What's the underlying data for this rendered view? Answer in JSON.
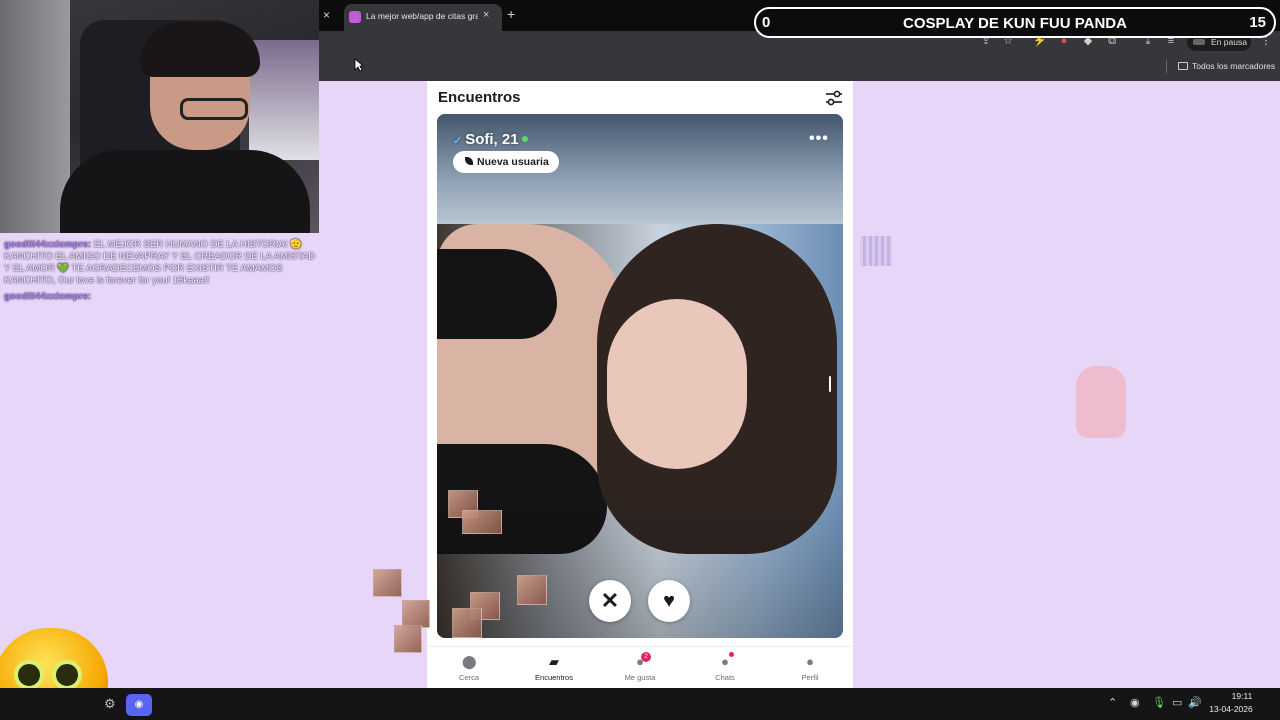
{
  "browser": {
    "tab_title": "La mejor web/app de citas gratis",
    "tab_close": "×",
    "new_tab": "+",
    "close_left": "×",
    "profile_status": "En pausa",
    "all_bookmarks": "Todos los marcadores"
  },
  "stream": {
    "left_counter": "0",
    "title": "COSPLAY DE KUN FUU PANDA",
    "right_counter": "15"
  },
  "chat": {
    "messages": [
      {
        "user": "goodlii44xxiompre:",
        "text": "EL MEJOR SER HUMANO DE LA HISTORIA! 🫡 KANCHITO EL AMIGO DE NEVAPRAY Y EL CREADOR DE LA AMISTAD Y EL AMOR 💚 TE AGRADECEMOS POR EXISTIR TE AMAMOS KANCHITO, Our love is forever for you! 15kaaa!!"
      },
      {
        "user": "goodlii44xxiompre:",
        "text": ""
      }
    ]
  },
  "app": {
    "title": "Encuentros",
    "card": {
      "name": "Sofi, 21",
      "badge": "Nueva usuaria",
      "more": "•••",
      "verified_icon": "✓"
    },
    "actions": {
      "dislike": "✕",
      "like": "♥"
    },
    "nav": [
      {
        "label": "Cerca",
        "icon": "location-pin-icon"
      },
      {
        "label": "Encuentros",
        "icon": "cards-icon"
      },
      {
        "label": "Me gusta",
        "icon": "likes-icon",
        "badge": "2"
      },
      {
        "label": "Chats",
        "icon": "chat-icon"
      },
      {
        "label": "Perfil",
        "icon": "person-icon"
      }
    ]
  },
  "taskbar": {
    "time": "19:11",
    "date": "13-04-2026"
  },
  "colors": {
    "page_background": "#e8d6f8",
    "notification_badge": "#e0245e",
    "discord": "#5865f2"
  }
}
